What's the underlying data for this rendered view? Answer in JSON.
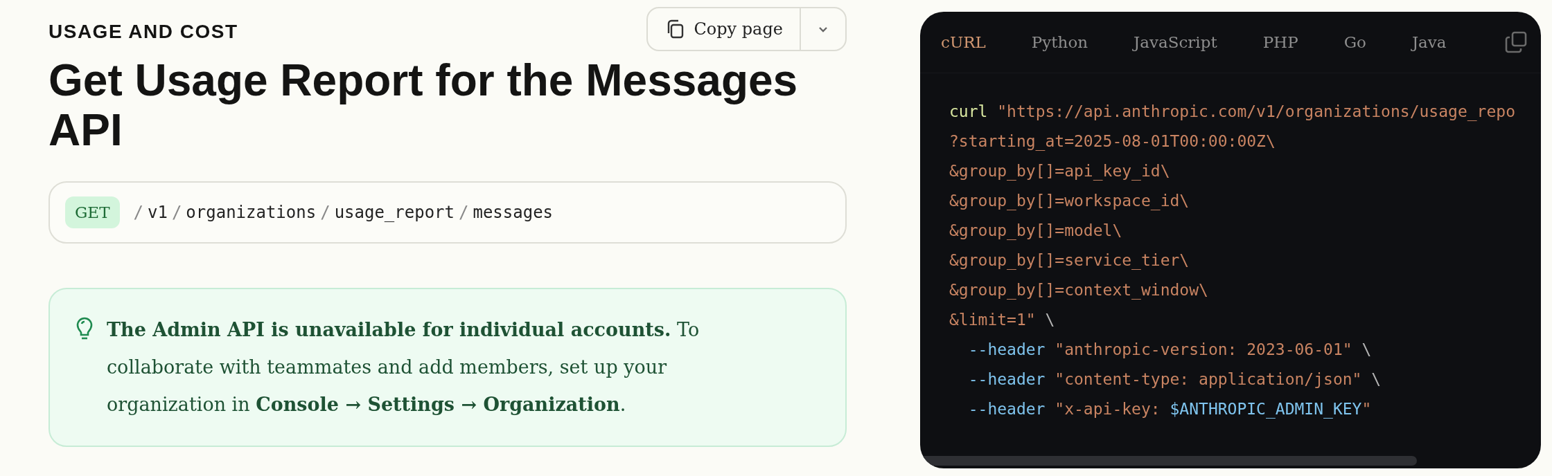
{
  "breadcrumb": "USAGE AND COST",
  "copy_button": {
    "label": "Copy page"
  },
  "title": "Get Usage Report for the Messages API",
  "endpoint": {
    "method": "GET",
    "segments": [
      {
        "sep": "/",
        "text": "v1"
      },
      {
        "sep": "/",
        "text": "organizations"
      },
      {
        "sep": "/",
        "text": "usage_report"
      },
      {
        "sep": "/",
        "text": "messages"
      }
    ]
  },
  "callout": {
    "text": "**The Admin API is unavailable for individual accounts.** To collaborate with teammates and add members, set up your organization in **Console → Settings → Organization**."
  },
  "code_panel": {
    "tabs": [
      {
        "label": "cURL",
        "selected": true
      },
      {
        "label": "Python",
        "selected": false
      },
      {
        "label": "JavaScript",
        "selected": false
      },
      {
        "label": "PHP",
        "selected": false
      },
      {
        "label": "Go",
        "selected": false
      },
      {
        "label": "Java",
        "selected": false
      }
    ],
    "lines": [
      {
        "tokens": [
          {
            "kind": "command",
            "text": "curl"
          },
          {
            "kind": "string",
            "text": " \"https://api.anthropic.com/v1/organizations/usage_repo"
          }
        ]
      },
      {
        "tokens": [
          {
            "kind": "string",
            "text": "?starting_at=2025-08-01T00:00:00Z\\"
          }
        ]
      },
      {
        "tokens": [
          {
            "kind": "string",
            "text": "&group_by[]=api_key_id\\"
          }
        ]
      },
      {
        "tokens": [
          {
            "kind": "string",
            "text": "&group_by[]=workspace_id\\"
          }
        ]
      },
      {
        "tokens": [
          {
            "kind": "string",
            "text": "&group_by[]=model\\"
          }
        ]
      },
      {
        "tokens": [
          {
            "kind": "string",
            "text": "&group_by[]=service_tier\\"
          }
        ]
      },
      {
        "tokens": [
          {
            "kind": "string",
            "text": "&group_by[]=context_window\\"
          }
        ]
      },
      {
        "tokens": [
          {
            "kind": "string",
            "text": "&limit=1\""
          },
          {
            "kind": "plain",
            "text": " \\"
          }
        ]
      },
      {
        "tokens": [
          {
            "kind": "flag",
            "text": "  --header"
          },
          {
            "kind": "string",
            "text": " \"anthropic-version: 2023-06-01\""
          },
          {
            "kind": "plain",
            "text": " \\"
          }
        ]
      },
      {
        "tokens": [
          {
            "kind": "flag",
            "text": "  --header"
          },
          {
            "kind": "string",
            "text": " \"content-type: application/json\""
          },
          {
            "kind": "plain",
            "text": " \\"
          }
        ]
      },
      {
        "tokens": [
          {
            "kind": "flag",
            "text": "  --header"
          },
          {
            "kind": "string",
            "text": " \"x-api-key: "
          },
          {
            "kind": "variable",
            "text": "$ANTHROPIC_ADMIN_KEY"
          },
          {
            "kind": "string",
            "text": "\""
          }
        ]
      }
    ]
  }
}
